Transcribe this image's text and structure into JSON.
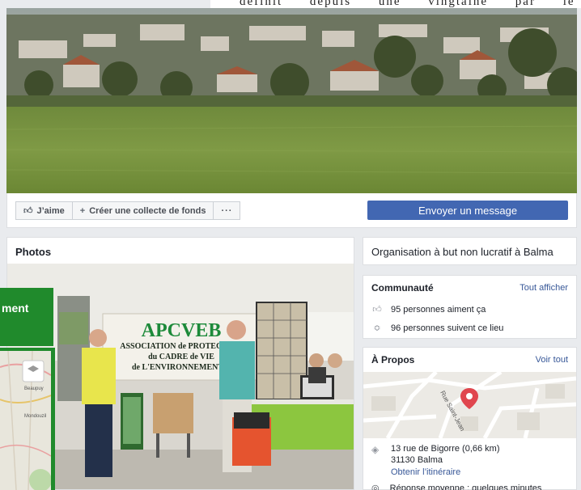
{
  "top_text": "définit depuis une vingtaine par le passé dans les",
  "actions": {
    "like": "J’aime",
    "fundraiser": "Créer une collecte de fonds",
    "more": "···",
    "message": "Envoyer un message"
  },
  "photos": {
    "title": "Photos",
    "banner_line1": "APCVEB",
    "banner_line2": "ASSOCIATION de PROTECTION",
    "banner_line3": "du CADRE de VIE",
    "banner_line4": "de L'ENVIRONNEMENT B"
  },
  "side_panel": {
    "heading": "ment",
    "map_label1": "Beaupuy",
    "map_label2": "Mondouzil"
  },
  "org": {
    "category": "Organisation à but non lucratif à Balma"
  },
  "community": {
    "title": "Communauté",
    "see_all": "Tout afficher",
    "likes": "95 personnes aiment ça",
    "follows": "96 personnes suivent ce lieu"
  },
  "about": {
    "title": "À Propos",
    "see_all": "Voir tout",
    "street_label": "Rue Saint-Jean",
    "address_line1": "13 rue de Bigorre (0,66 km)",
    "address_line2": "31130 Balma",
    "directions": "Obtenir l’itinéraire",
    "response": "Réponse moyenne : quelques minutes"
  },
  "colors": {
    "brand_blue": "#4267b2",
    "link_blue": "#385898",
    "green_panel": "#208a2c",
    "map_pin": "#e0464e"
  },
  "icons": [
    "thumbs-up-icon",
    "plus-icon",
    "more-icon",
    "like-icon",
    "rss-icon",
    "location-icon",
    "chat-icon",
    "map-pin-icon"
  ]
}
